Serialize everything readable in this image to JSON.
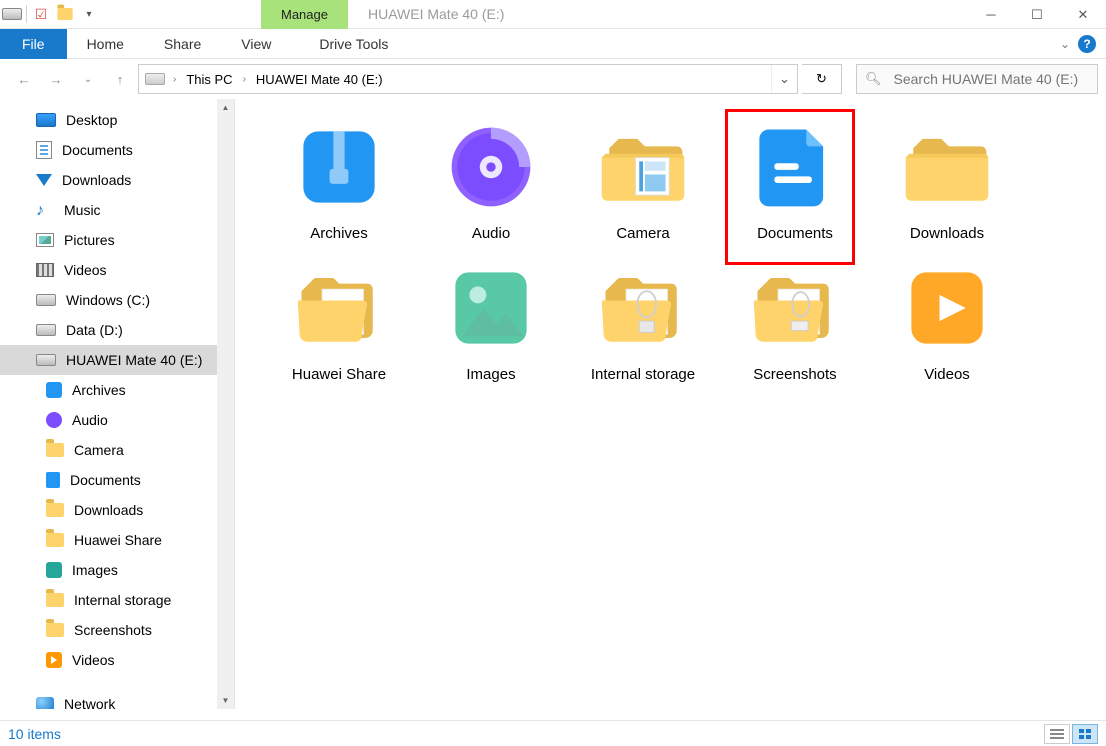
{
  "window": {
    "manage_tab": "Manage",
    "title": "HUAWEI Mate 40 (E:)"
  },
  "ribbon": {
    "file": "File",
    "tabs": [
      "Home",
      "Share",
      "View"
    ],
    "drive_tools": "Drive Tools"
  },
  "breadcrumb": {
    "segments": [
      "This PC",
      "HUAWEI Mate 40 (E:)"
    ]
  },
  "search": {
    "placeholder": "Search HUAWEI Mate 40 (E:)"
  },
  "tree": {
    "top": [
      {
        "label": "Desktop",
        "iconClass": "ico-desktop"
      },
      {
        "label": "Documents",
        "iconClass": "ico-doc"
      },
      {
        "label": "Downloads",
        "iconClass": "ico-dl"
      },
      {
        "label": "Music",
        "iconClass": "ico-music"
      },
      {
        "label": "Pictures",
        "iconClass": "ico-pic"
      },
      {
        "label": "Videos",
        "iconClass": "ico-vid"
      },
      {
        "label": "Windows (C:)",
        "iconClass": "ico-drive"
      },
      {
        "label": "Data (D:)",
        "iconClass": "ico-drive"
      },
      {
        "label": "HUAWEI Mate 40 (E:)",
        "iconClass": "ico-drive",
        "selected": true
      }
    ],
    "children": [
      {
        "label": "Archives",
        "iconClass": "ico-archives"
      },
      {
        "label": "Audio",
        "iconClass": "ico-audio"
      },
      {
        "label": "Camera",
        "iconClass": "ico-folder"
      },
      {
        "label": "Documents",
        "iconClass": "ico-docblue"
      },
      {
        "label": "Downloads",
        "iconClass": "ico-folder"
      },
      {
        "label": "Huawei Share",
        "iconClass": "ico-folder"
      },
      {
        "label": "Images",
        "iconClass": "ico-images"
      },
      {
        "label": "Internal storage",
        "iconClass": "ico-folder"
      },
      {
        "label": "Screenshots",
        "iconClass": "ico-folder"
      },
      {
        "label": "Videos",
        "iconClass": "ico-videos"
      }
    ],
    "network": "Network"
  },
  "items": [
    {
      "label": "Archives",
      "icon": "archives"
    },
    {
      "label": "Audio",
      "icon": "audio"
    },
    {
      "label": "Camera",
      "icon": "camera"
    },
    {
      "label": "Documents",
      "icon": "documents",
      "highlighted": true
    },
    {
      "label": "Downloads",
      "icon": "folder"
    },
    {
      "label": "Huawei Share",
      "icon": "folder-open"
    },
    {
      "label": "Images",
      "icon": "images"
    },
    {
      "label": "Internal storage",
      "icon": "internal"
    },
    {
      "label": "Screenshots",
      "icon": "screenshots"
    },
    {
      "label": "Videos",
      "icon": "videos"
    }
  ],
  "status": {
    "count_text": "10 items"
  }
}
